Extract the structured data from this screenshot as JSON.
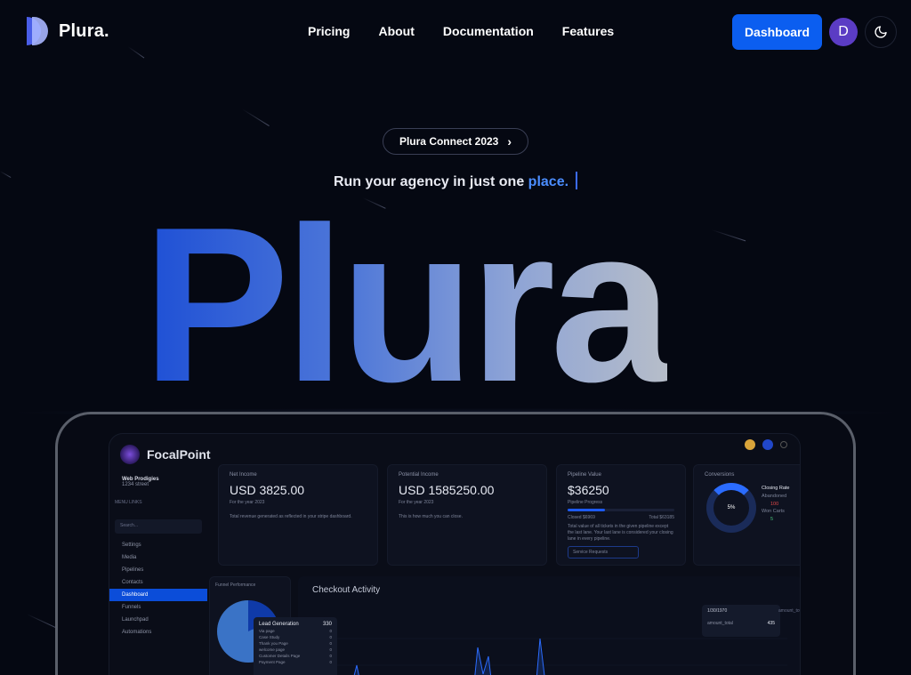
{
  "header": {
    "logo_text": "Plura.",
    "nav": [
      "Pricing",
      "About",
      "Documentation",
      "Features"
    ],
    "dashboard_label": "Dashboard",
    "avatar_initial": "D"
  },
  "hero": {
    "pill_label": "Plura Connect 2023",
    "pill_chevron": "›",
    "tagline_prefix": "Run your agency in just one ",
    "tagline_accent": "place.",
    "big_word": "Plura"
  },
  "preview": {
    "app_name": "FocalPoint",
    "account_name": "Web Prodigies",
    "account_address": "1234 street",
    "menu_label": "MENU LINKS",
    "search_placeholder": "Search...",
    "menu": [
      "Settings",
      "Media",
      "Pipelines",
      "Contacts",
      "Dashboard",
      "Funnels",
      "Launchpad",
      "Automations"
    ],
    "active_menu": "Dashboard",
    "cards": [
      {
        "title": "Net Income",
        "value": "USD 3825.00",
        "sub": "For the year 2023",
        "desc": "Total revenue generated as reflected in your stripe dashboard."
      },
      {
        "title": "Potential Income",
        "value": "USD 1585250.00",
        "sub": "For the year 2023",
        "desc": "This is how much you can close."
      },
      {
        "title": "Pipeline Value",
        "value": "$36250",
        "sub": "Pipeline Progress",
        "closed": "Closed $6969",
        "total": "Total $63185",
        "desc": "Total value of all tickets in the given pipeline except the last lane. Your last lane is considered your closing lane in every pipeline.",
        "select": "Service Requests"
      }
    ],
    "pipeline_progress": 0.35,
    "conversions": {
      "title": "Conversions",
      "center": "5%",
      "closing_rate": "Closing Rate",
      "abandoned_label": "Abandoned",
      "abandoned_value": "100",
      "won_label": "Won Carts",
      "won_value": "5",
      "progress": 0.25
    },
    "funnel": {
      "title": "Funnel Performance",
      "tooltip_title": "Lead Generation",
      "tooltip_value": "330",
      "tooltip_rows": [
        {
          "label": "Via page",
          "value": "0"
        },
        {
          "label": "Case Study",
          "value": "0"
        },
        {
          "label": "Thank you Page",
          "value": "0"
        },
        {
          "label": "welcome page",
          "value": "0"
        },
        {
          "label": "Customer Details Page",
          "value": "0"
        },
        {
          "label": "Payment Page",
          "value": "0"
        }
      ]
    },
    "checkout": {
      "title": "Checkout Activity",
      "tooltip_date": "1/30/1970",
      "tooltip_series": "amount_total",
      "tooltip_value": "435",
      "legend": "amount_total"
    }
  },
  "colors": {
    "background": "#050812",
    "accent": "#0b5ef0",
    "tagline_accent": "#4b8dff",
    "avatar": "#5b3cc4"
  }
}
